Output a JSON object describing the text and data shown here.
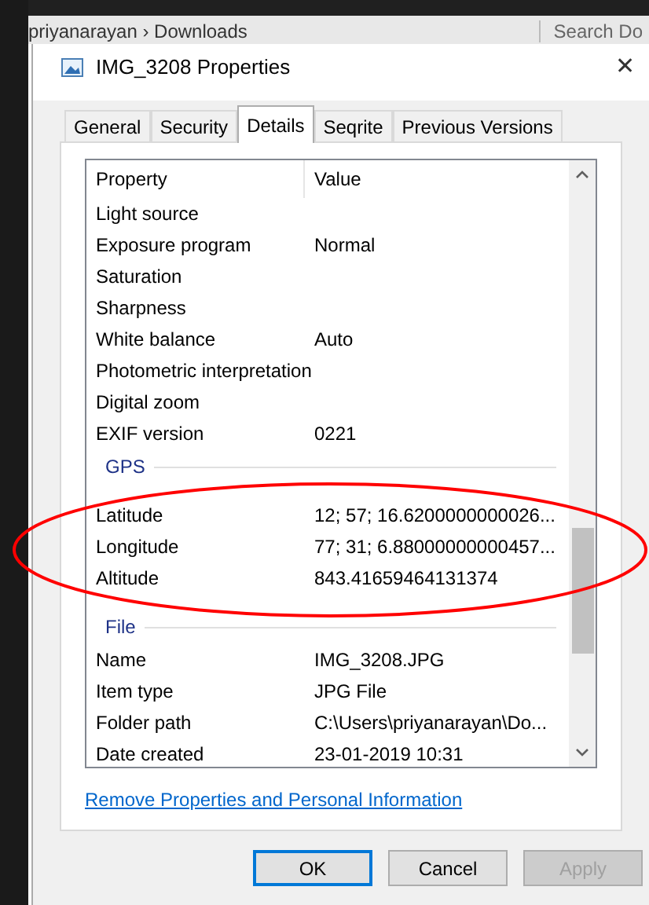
{
  "explorer": {
    "breadcrumb": "priyanarayan  ›  Downloads",
    "search_placeholder": "Search Do"
  },
  "window": {
    "title": "IMG_3208 Properties",
    "close": "✕"
  },
  "tabs": [
    {
      "label": "General",
      "selected": false
    },
    {
      "label": "Security",
      "selected": false
    },
    {
      "label": "Details",
      "selected": true
    },
    {
      "label": "Seqrite",
      "selected": false
    },
    {
      "label": "Previous Versions",
      "selected": false
    }
  ],
  "table": {
    "columns": [
      "Property",
      "Value"
    ],
    "rows": [
      {
        "kind": "row",
        "property": "Light source",
        "value": ""
      },
      {
        "kind": "row",
        "property": "Exposure program",
        "value": "Normal"
      },
      {
        "kind": "row",
        "property": "Saturation",
        "value": ""
      },
      {
        "kind": "row",
        "property": "Sharpness",
        "value": ""
      },
      {
        "kind": "row",
        "property": "White balance",
        "value": "Auto"
      },
      {
        "kind": "row",
        "property": "Photometric interpretation",
        "value": ""
      },
      {
        "kind": "row",
        "property": "Digital zoom",
        "value": ""
      },
      {
        "kind": "row",
        "property": "EXIF version",
        "value": "0221"
      },
      {
        "kind": "group",
        "property": "GPS"
      },
      {
        "kind": "row",
        "property": "Latitude",
        "value": "12; 57; 16.6200000000026..."
      },
      {
        "kind": "row",
        "property": "Longitude",
        "value": "77; 31; 6.88000000000457..."
      },
      {
        "kind": "row",
        "property": "Altitude",
        "value": "843.41659464131374"
      },
      {
        "kind": "group",
        "property": "File"
      },
      {
        "kind": "row",
        "property": "Name",
        "value": "IMG_3208.JPG"
      },
      {
        "kind": "row",
        "property": "Item type",
        "value": "JPG File"
      },
      {
        "kind": "row",
        "property": "Folder path",
        "value": "C:\\Users\\priyanarayan\\Do..."
      },
      {
        "kind": "row",
        "property": "Date created",
        "value": "23-01-2019 10:31"
      }
    ]
  },
  "link": "Remove Properties and Personal Information",
  "buttons": [
    {
      "label": "OK",
      "default": true,
      "disabled": false
    },
    {
      "label": "Cancel",
      "default": false,
      "disabled": false
    },
    {
      "label": "Apply",
      "default": false,
      "disabled": true
    }
  ]
}
